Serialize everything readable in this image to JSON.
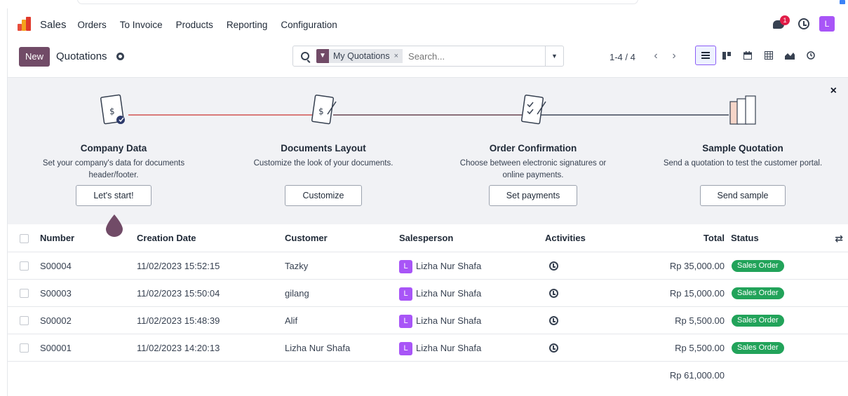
{
  "navbar": {
    "app_name": "Sales",
    "menu": [
      "Orders",
      "To Invoice",
      "Products",
      "Reporting",
      "Configuration"
    ],
    "chat_badge": "1",
    "user_initial": "L"
  },
  "control": {
    "new_label": "New",
    "title": "Quotations",
    "search": {
      "facet": "My Quotations",
      "facet_close": "×",
      "placeholder": "Search..."
    },
    "pager": "1-4 / 4",
    "views": [
      "list-view-icon",
      "kanban-view-icon",
      "calendar-view-icon",
      "pivot-view-icon",
      "graph-view-icon",
      "activity-view-icon"
    ]
  },
  "banner": {
    "close": "×",
    "steps": [
      {
        "title": "Company Data",
        "desc": "Set your company's data for documents header/footer.",
        "button": "Let's start!"
      },
      {
        "title": "Documents Layout",
        "desc": "Customize the look of your documents.",
        "button": "Customize"
      },
      {
        "title": "Order Confirmation",
        "desc": "Choose between electronic signatures or online payments.",
        "button": "Set payments"
      },
      {
        "title": "Sample Quotation",
        "desc": "Send a quotation to test the customer portal.",
        "button": "Send sample"
      }
    ]
  },
  "table": {
    "headers": {
      "number": "Number",
      "date": "Creation Date",
      "customer": "Customer",
      "salesperson": "Salesperson",
      "activities": "Activities",
      "total": "Total",
      "status": "Status"
    },
    "rows": [
      {
        "number": "S00004",
        "date": "11/02/2023 15:52:15",
        "customer": "Tazky",
        "sp_initial": "L",
        "salesperson": "Lizha Nur Shafa",
        "total": "Rp 35,000.00",
        "status": "Sales Order"
      },
      {
        "number": "S00003",
        "date": "11/02/2023 15:50:04",
        "customer": "gilang",
        "sp_initial": "L",
        "salesperson": "Lizha Nur Shafa",
        "total": "Rp 15,000.00",
        "status": "Sales Order"
      },
      {
        "number": "S00002",
        "date": "11/02/2023 15:48:39",
        "customer": "Alif",
        "sp_initial": "L",
        "salesperson": "Lizha Nur Shafa",
        "total": "Rp 5,500.00",
        "status": "Sales Order"
      },
      {
        "number": "S00001",
        "date": "11/02/2023 14:20:13",
        "customer": "Lizha Nur Shafa",
        "sp_initial": "L",
        "salesperson": "Lizha Nur Shafa",
        "total": "Rp 5,500.00",
        "status": "Sales Order"
      }
    ],
    "grand_total": "Rp 61,000.00"
  },
  "colors": {
    "brand": "#714b67",
    "status_green": "#22a35a",
    "avatar": "#a855f7"
  }
}
